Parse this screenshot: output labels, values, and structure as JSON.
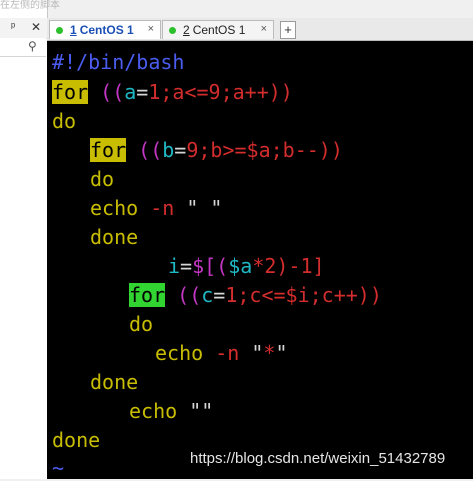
{
  "left_panel": {
    "hint_text": "在左侧的脚本按钮。",
    "pin_icon": "pin-icon",
    "close_icon": "close-x-icon",
    "search_icon": "search-icon"
  },
  "tabs": [
    {
      "number": "1",
      "label": "CentOS 1",
      "active": true,
      "close": "×"
    },
    {
      "number": "2",
      "label": "CentOS 1",
      "active": false,
      "close": "×"
    }
  ],
  "new_tab_label": "+",
  "colors": {
    "shebang": "#4b5cf0",
    "keyword": "#c8bd00",
    "number_op": "#d32d2d",
    "variable": "#1fb8c4",
    "expansion": "#c437c4",
    "terminal_bg": "#000000",
    "status_dot": "#2cc02c"
  },
  "terminal": {
    "shebang": "#!/bin/bash",
    "l1": {
      "kw": "for",
      "p1": " ((",
      "var": "a",
      "eq": "=",
      "rest": "1;a<=9;a++))"
    },
    "l2": "do",
    "l3": {
      "kw": "for",
      "p1": " ((",
      "var": "b",
      "eq": "=",
      "rest": "9;b>=$a;b--))"
    },
    "l4": "do",
    "l5": {
      "cmd": "echo ",
      "opt": "-n",
      "str": " \" \""
    },
    "l6": "done",
    "l7": {
      "var": "i",
      "eq": "=",
      "expr_open": "$[(",
      "expr_var": "$a",
      "expr_rest": "*2)-1]"
    },
    "l8": {
      "kw": "for",
      "p1": " ((",
      "var": "c",
      "eq": "=",
      "rest": "1;c<=$i;c++))"
    },
    "l9": "do",
    "l10": {
      "cmd": "echo ",
      "opt": "-n",
      "str_q1": " \"",
      "str_star": "*",
      "str_q2": "\""
    },
    "l11": "done",
    "l12": {
      "cmd": "echo ",
      "str": "\"\""
    },
    "l13": "done",
    "tilde": "~"
  },
  "watermark": "https://blog.csdn.net/weixin_51432789"
}
